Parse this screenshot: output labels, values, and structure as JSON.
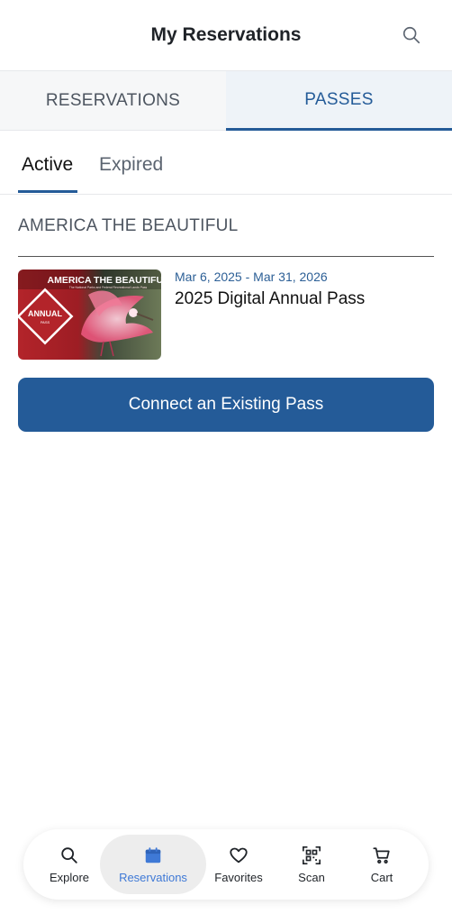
{
  "header": {
    "title": "My Reservations",
    "search_icon": "search-icon"
  },
  "main_tabs": [
    {
      "label": "RESERVATIONS",
      "active": false
    },
    {
      "label": "PASSES",
      "active": true
    }
  ],
  "sub_tabs": [
    {
      "label": "Active",
      "active": true
    },
    {
      "label": "Expired",
      "active": false
    }
  ],
  "section": {
    "title": "AMERICA THE BEAUTIFUL"
  },
  "pass": {
    "dates": "Mar 6, 2025 - Mar 31, 2026",
    "name": "2025 Digital Annual Pass",
    "thumb_title": "AMERICA THE BEAUTIFUL",
    "thumb_subtitle": "The National Parks and Federal Recreational Lands Pass",
    "thumb_badge": "ANNUAL",
    "thumb_badge_sub": "PASS"
  },
  "connect_button": {
    "label": "Connect an Existing Pass"
  },
  "bottom_nav": [
    {
      "label": "Explore",
      "icon": "search-icon",
      "active": false
    },
    {
      "label": "Reservations",
      "icon": "calendar-icon",
      "active": true
    },
    {
      "label": "Favorites",
      "icon": "heart-icon",
      "active": false
    },
    {
      "label": "Scan",
      "icon": "qr-code-icon",
      "active": false
    },
    {
      "label": "Cart",
      "icon": "cart-icon",
      "active": false
    }
  ],
  "colors": {
    "primary": "#245b98",
    "nav_active": "#3f79d6",
    "thumb_red": "#b3242a"
  }
}
